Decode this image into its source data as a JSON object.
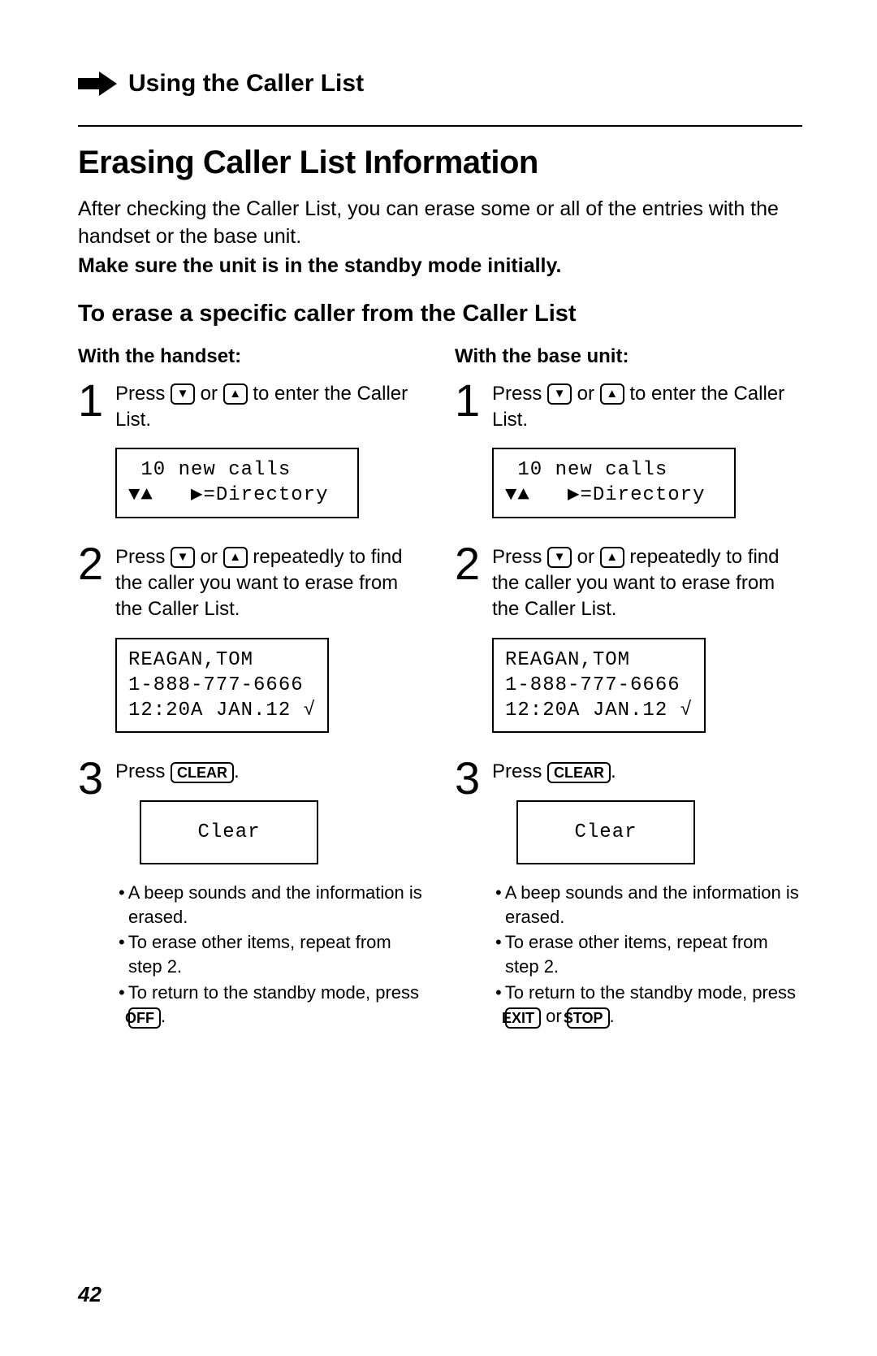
{
  "breadcrumb": "Using the Caller List",
  "title": "Erasing Caller List Information",
  "intro": "After checking the Caller List, you can erase some or all of the entries with the handset or the base unit.",
  "bold_note": "Make sure the unit is in the standby mode initially.",
  "subheading": "To erase a specific caller from the Caller List",
  "page_number": "42",
  "key_down": "▼",
  "key_up": "▲",
  "key_clear": "CLEAR",
  "key_off": "OFF",
  "key_exit": "EXIT",
  "key_stop": "STOP",
  "left": {
    "heading": "With the handset:",
    "step1": {
      "num": "1",
      "pre": "Press ",
      "mid": " or ",
      "post": " to enter the Caller List.",
      "lcd_line1": " 10 new calls",
      "lcd_line2": "▼▲   ▶=Directory"
    },
    "step2": {
      "num": "2",
      "pre": "Press ",
      "mid": " or ",
      "post": " repeatedly to find the caller you want to erase from the Caller List.",
      "lcd_line1": "REAGAN,TOM",
      "lcd_line2": "1-888-777-6666",
      "lcd_line3": "12:20A JAN.12 √"
    },
    "step3": {
      "num": "3",
      "pre": "Press ",
      "post": ".",
      "lcd": "Clear",
      "bullet1": "A beep sounds and the information is erased.",
      "bullet2": "To erase other items, repeat from step 2.",
      "bullet3_pre": "To return to the standby mode, press ",
      "bullet3_post": "."
    }
  },
  "right": {
    "heading": "With the base unit:",
    "step1": {
      "num": "1",
      "pre": "Press ",
      "mid": " or ",
      "post": " to enter the Caller List.",
      "lcd_line1": " 10 new calls",
      "lcd_line2": "▼▲   ▶=Directory"
    },
    "step2": {
      "num": "2",
      "pre": "Press ",
      "mid": " or ",
      "post": " repeatedly to find the caller you want to erase from the Caller List.",
      "lcd_line1": "REAGAN,TOM",
      "lcd_line2": "1-888-777-6666",
      "lcd_line3": "12:20A JAN.12 √"
    },
    "step3": {
      "num": "3",
      "pre": "Press ",
      "post": ".",
      "lcd": "Clear",
      "bullet1": "A beep sounds and the information is erased.",
      "bullet2": "To erase other items, repeat from step 2.",
      "bullet3_pre": "To return to the standby mode, press ",
      "bullet3_mid": " or ",
      "bullet3_post": "."
    }
  }
}
